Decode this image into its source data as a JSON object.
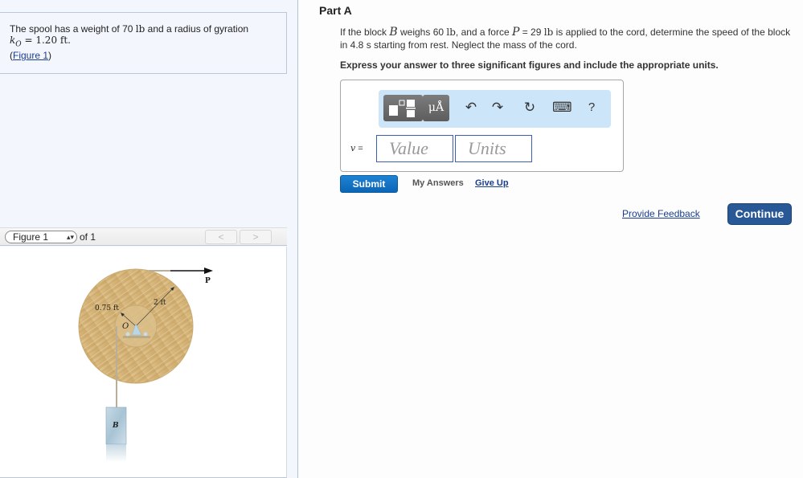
{
  "intro": {
    "line1_text": "The spool has a weight of 70 ",
    "line1_unit": "lb",
    "line1_rest": " and a radius of gyration",
    "line2_symbol": "k",
    "line2_sub": "O",
    "line2_value": " = 1.20 ft.",
    "figure_link_open": "(",
    "figure_link": "Figure 1",
    "figure_link_close": ")"
  },
  "figure_nav": {
    "selected": "Figure 1",
    "select_arrows": "▴▾",
    "of_label": "of 1",
    "prev_label": "<",
    "next_label": ">"
  },
  "figure": {
    "labels": {
      "force": "P",
      "outer_radius": "2 ft",
      "inner_radius": "0.75 ft",
      "center": "O",
      "block": "B"
    }
  },
  "part": {
    "title": "Part A",
    "question_1": "If the block ",
    "question_B": "B",
    "question_2": " weighs 60 ",
    "question_lb1": "lb",
    "question_3": ", and a force ",
    "question_P": "P",
    "question_4": " = 29 ",
    "question_lb2": "lb",
    "question_5": " is applied to the cord, determine the speed of the block in 4.8 s starting from rest. Neglect the mass of the cord.",
    "instruction": "Express your answer to three significant figures and include the appropriate units."
  },
  "toolbar": {
    "units_label": "μÅ",
    "undo_icon": "↶",
    "redo_icon": "↷",
    "reset_icon": "↻",
    "keyboard_icon": "⌨",
    "help_label": "?"
  },
  "answer": {
    "variable": "v",
    "equals": " =",
    "value_placeholder": "Value",
    "units_placeholder": "Units"
  },
  "actions": {
    "submit": "Submit",
    "my_answers": "My Answers",
    "give_up": "Give Up",
    "feedback": "Provide Feedback",
    "continue": "Continue"
  }
}
